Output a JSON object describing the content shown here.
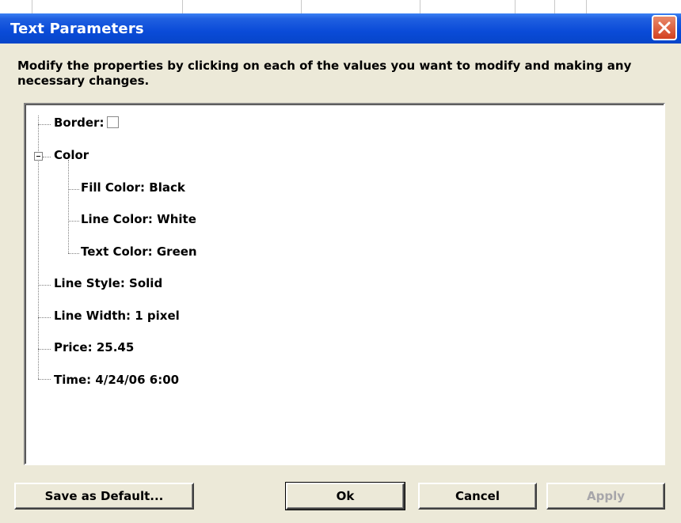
{
  "window": {
    "title": "Text Parameters"
  },
  "description": "Modify the properties by clicking on each of the values you want to modify and making any necessary changes.",
  "tree": {
    "border_label": "Border:",
    "color_label": "Color",
    "fill_color": "Fill Color: Black",
    "line_color": "Line Color: White",
    "text_color": "Text Color: Green",
    "line_style": "Line Style: Solid",
    "line_width": "Line Width: 1 pixel",
    "price": "Price: 25.45",
    "time": "Time: 4/24/06 6:00"
  },
  "buttons": {
    "save_default": "Save as Default...",
    "ok": "Ok",
    "cancel": "Cancel",
    "apply": "Apply"
  }
}
